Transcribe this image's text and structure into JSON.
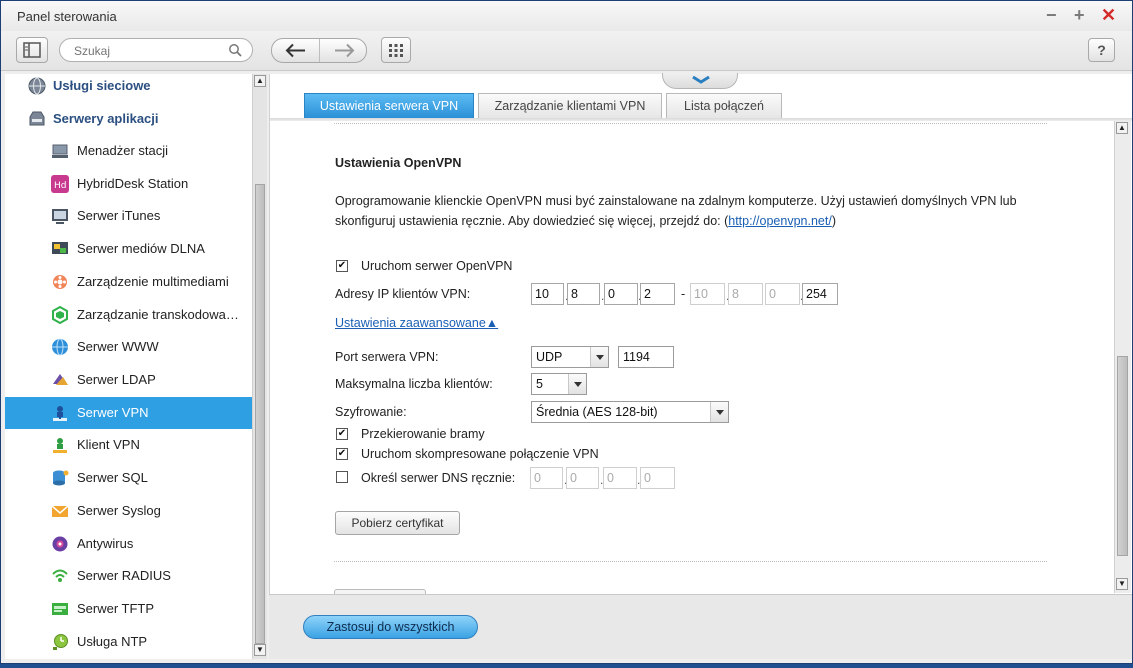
{
  "window": {
    "title": "Panel sterowania",
    "minimize": "−",
    "maximize": "+",
    "close": "✕"
  },
  "toolbar": {
    "search_placeholder": "Szukaj",
    "help": "?"
  },
  "sidebar": {
    "categories": [
      {
        "label": "Usługi sieciowe",
        "icon": "globe-icon"
      },
      {
        "label": "Serwery aplikacji",
        "icon": "server-icon"
      }
    ],
    "items": [
      {
        "label": "Menadżer stacji",
        "icon": "station-manager-icon"
      },
      {
        "label": "HybridDesk Station",
        "icon": "hybriddesk-icon"
      },
      {
        "label": "Serwer iTunes",
        "icon": "itunes-icon"
      },
      {
        "label": "Serwer mediów DLNA",
        "icon": "dlna-icon"
      },
      {
        "label": "Zarządzenie multimediami",
        "icon": "multimedia-icon"
      },
      {
        "label": "Zarządzanie transkodowaniem",
        "icon": "transcode-icon"
      },
      {
        "label": "Serwer WWW",
        "icon": "www-icon"
      },
      {
        "label": "Serwer LDAP",
        "icon": "ldap-icon"
      },
      {
        "label": "Serwer VPN",
        "icon": "vpn-server-icon"
      },
      {
        "label": "Klient VPN",
        "icon": "vpn-client-icon"
      },
      {
        "label": "Serwer SQL",
        "icon": "sql-icon"
      },
      {
        "label": "Serwer Syslog",
        "icon": "syslog-icon"
      },
      {
        "label": "Antywirus",
        "icon": "antivirus-icon"
      },
      {
        "label": "Serwer RADIUS",
        "icon": "radius-icon"
      },
      {
        "label": "Serwer TFTP",
        "icon": "tftp-icon"
      },
      {
        "label": "Usługa NTP",
        "icon": "ntp-icon"
      }
    ],
    "active_index": 8
  },
  "tabs": [
    {
      "label": "Ustawienia serwera VPN",
      "active": true
    },
    {
      "label": "Zarządzanie klientami VPN",
      "active": false
    },
    {
      "label": "Lista połączeń",
      "active": false
    }
  ],
  "content": {
    "section_title": "Ustawienia OpenVPN",
    "desc_text": "Oprogramowanie klienckie OpenVPN musi być zainstalowane na zdalnym komputerze. Użyj ustawień domyślnych VPN lub skonfiguruj ustawienia ręcznie. Aby dowiedzieć się więcej, przejdź do: (",
    "desc_link": "http://openvpn.net/",
    "desc_end": ")",
    "enable_label": "Uruchom serwer OpenVPN",
    "enable_checked": true,
    "ip_label": "Adresy IP klientów VPN:",
    "ip_start": [
      "10",
      "8",
      "0",
      "2"
    ],
    "ip_dash": "-",
    "ip_end": [
      "10",
      "8",
      "0",
      "254"
    ],
    "advanced_label": "Ustawienia zaawansowane▲",
    "port_label": "Port serwera VPN:",
    "protocol": "UDP",
    "port": "1194",
    "max_clients_label": "Maksymalna liczba klientów:",
    "max_clients": "5",
    "encryption_label": "Szyfrowanie:",
    "encryption": "Średnia (AES 128-bit)",
    "gateway_label": "Przekierowanie bramy",
    "gateway_checked": true,
    "compress_label": "Uruchom skompresowane połączenie VPN",
    "compress_checked": true,
    "dns_label": "Określ serwer DNS ręcznie:",
    "dns_checked": false,
    "dns": [
      "0",
      "0",
      "0",
      "0"
    ],
    "cert_button": "Pobierz certyfikat"
  },
  "footer": {
    "apply_button": "Zastosuj do wszystkich"
  },
  "colors": {
    "accent": "#2f9fe4",
    "link": "#1a5fb4"
  }
}
